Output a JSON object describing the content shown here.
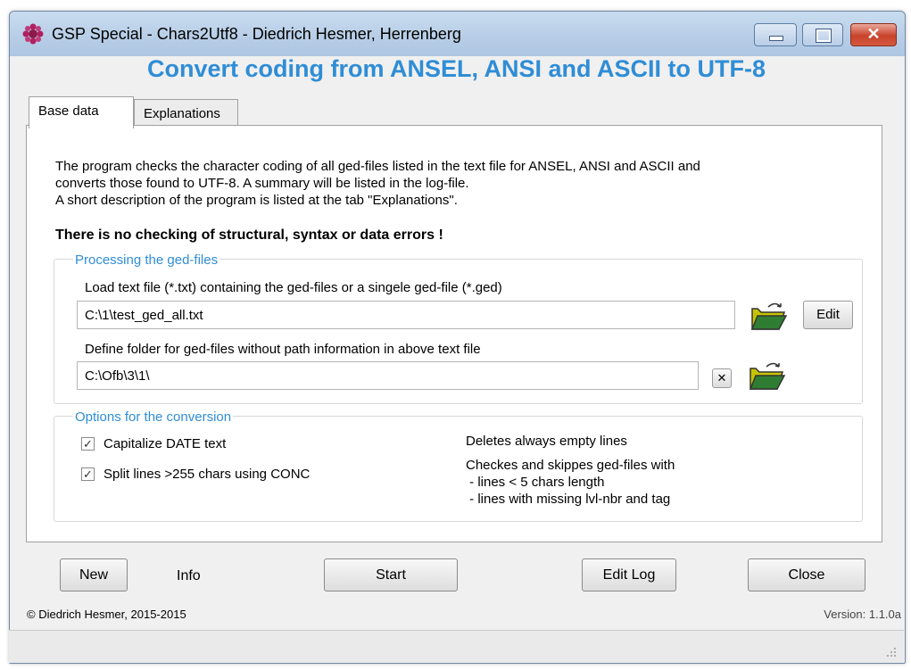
{
  "window": {
    "title": "GSP Special - Chars2Utf8  -  Diedrich Hesmer, Herrenberg",
    "close_glyph": "✕"
  },
  "heading": "Convert coding from ANSEL, ANSI and ASCII to UTF-8",
  "tabs": [
    {
      "label": "Base data",
      "active": true
    },
    {
      "label": "Explanations",
      "active": false
    }
  ],
  "intro": {
    "line1": "The program checks the character coding of all ged-files listed in the text file for ANSEL, ANSI and ASCII and",
    "line2": "converts those found to UTF-8. A summary will be listed in the log-file.",
    "line3": "A short description of the program is listed at the tab \"Explanations\".",
    "warning": "There is no checking of structural, syntax or data errors !"
  },
  "processing": {
    "group_title": "Processing the ged-files",
    "load_label": "Load text file (*.txt) containing the ged-files or a singele ged-file (*.ged)",
    "load_value": "C:\\1\\test_ged_all.txt",
    "edit_label": "Edit",
    "folder_label": "Define folder for ged-files without path information in above text file",
    "folder_value": "C:\\Ofb\\3\\1\\",
    "clear_glyph": "✕"
  },
  "options": {
    "group_title": "Options for the conversion",
    "capitalize_label": "Capitalize DATE text",
    "capitalize_checked": true,
    "split_label": "Split lines >255 chars using CONC",
    "split_checked": true,
    "check_glyph": "✓",
    "note1": "Deletes always empty lines",
    "note2": "Checkes and skippes ged-files with",
    "note3": " - lines < 5 chars length",
    "note4": " - lines with missing lvl-nbr and tag"
  },
  "buttons": {
    "new": "New",
    "info": "Info",
    "start": "Start",
    "edit_log": "Edit Log",
    "close": "Close"
  },
  "footer": {
    "copyright": "© Diedrich Hesmer,  2015-2015",
    "version": "Version: 1.1.0a"
  },
  "colors": {
    "accent": "#2f8dd6"
  }
}
